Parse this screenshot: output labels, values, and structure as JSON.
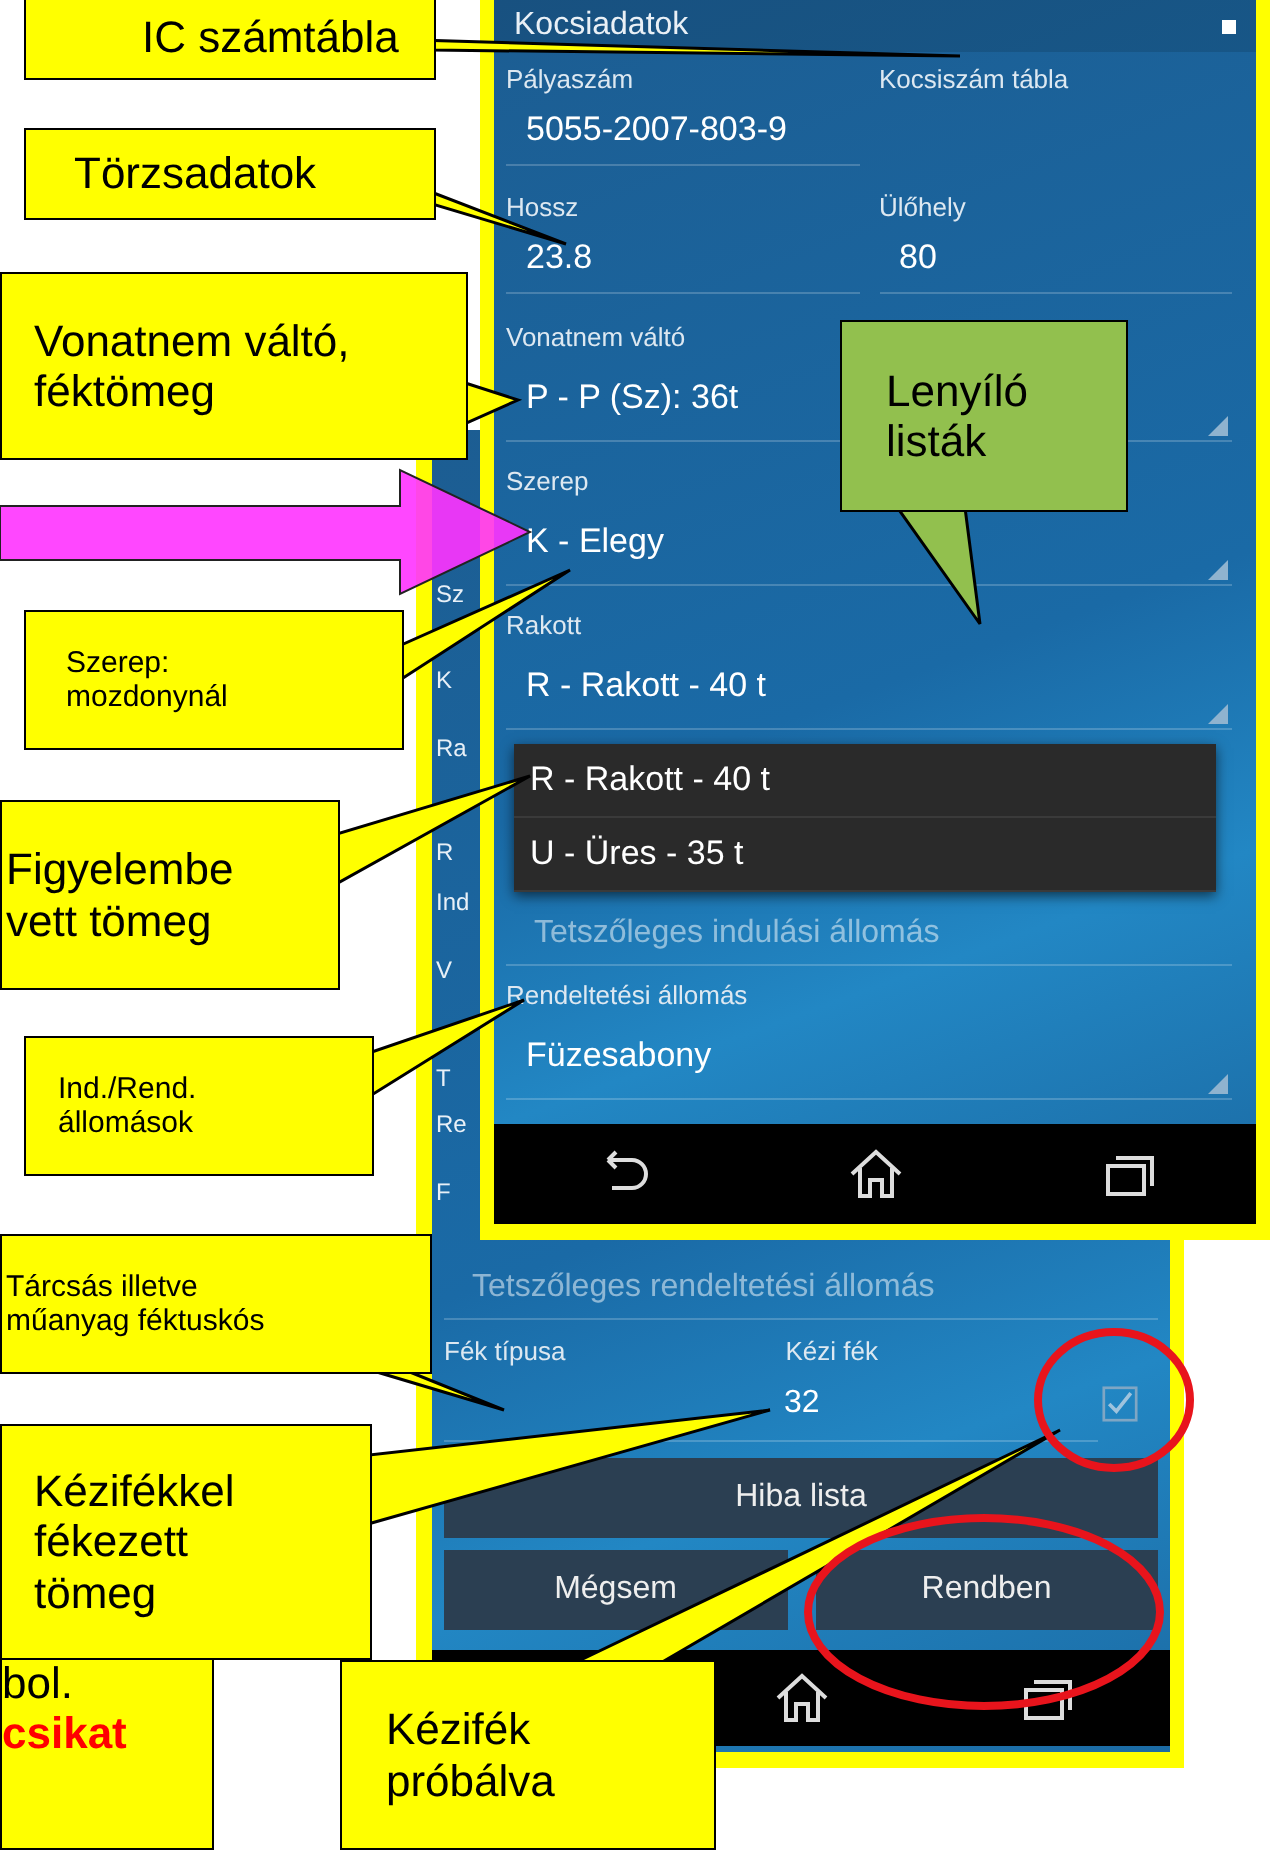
{
  "front_screen": {
    "title": "Kocsiadatok",
    "rows": [
      {
        "kind": "text",
        "labels": [
          "Pályaszám",
          "Kocsiszám tábla"
        ],
        "values": [
          "5055-2007-803-9"
        ]
      },
      {
        "kind": "text",
        "labels": [
          "Hossz",
          "Ülőhely"
        ],
        "values": [
          "23.8",
          "80"
        ]
      },
      {
        "kind": "spinner",
        "labels": [
          "Vonatnem váltó"
        ],
        "values": [
          "P - P (Sz): 36t"
        ]
      },
      {
        "kind": "spinner",
        "labels": [
          "Szerep"
        ],
        "values": [
          "K - Elegy"
        ]
      },
      {
        "kind": "spinner",
        "labels": [
          "Rakott"
        ],
        "values": [
          "R - Rakott - 40 t"
        ]
      },
      {
        "kind": "dropdown",
        "options": [
          "R - Rakott - 40 t",
          "U - Üres - 35 t"
        ]
      },
      {
        "kind": "placeholder",
        "placeholder": "Tetszőleges indulási állomás"
      },
      {
        "kind": "spinner",
        "labels": [
          "Rendeltetési állomás"
        ],
        "values": [
          "Füzesabony"
        ]
      }
    ]
  },
  "back_screen": {
    "edge_fragments": [
      "Sz",
      "K",
      "Ra",
      "R",
      "Ind",
      "V",
      "T",
      "Re",
      "F"
    ],
    "destination_placeholder": "Tetszőleges rendeltetési állomás",
    "brake_type_label": "Fék típusa",
    "hand_brake_label": "Kézi fék",
    "hand_brake_mass": "32",
    "hand_brake_checked": true,
    "buttons": [
      "Hiba lista",
      "Mégsem",
      "Rendben"
    ]
  },
  "partial_note": {
    "text": "bol.",
    "emphasis": "csikat"
  },
  "callouts": [
    {
      "kind": "yellow",
      "lines": [
        "IC számtábla"
      ]
    },
    {
      "kind": "yellow",
      "lines": [
        "Törzsadatok"
      ]
    },
    {
      "kind": "yellow",
      "lines": [
        "Vonatnem váltó,",
        "féktömeg"
      ]
    },
    {
      "kind": "green",
      "lines": [
        "Lenyíló",
        "listák"
      ]
    },
    {
      "kind": "yellow",
      "lines": [
        "Szerep:",
        "mozdonynál"
      ]
    },
    {
      "kind": "yellow",
      "lines": [
        "Figyelembe",
        "vett tömeg"
      ]
    },
    {
      "kind": "yellow",
      "lines": [
        "Ind./Rend.",
        "állomások"
      ]
    },
    {
      "kind": "yellow",
      "lines": [
        "Tárcsás illetve",
        "műanyag féktuskós"
      ]
    },
    {
      "kind": "yellow",
      "lines": [
        "Kézifékkel",
        "fékezett",
        "tömeg"
      ]
    },
    {
      "kind": "yellow",
      "lines": [
        "Kézifék",
        "próbálva"
      ]
    }
  ]
}
